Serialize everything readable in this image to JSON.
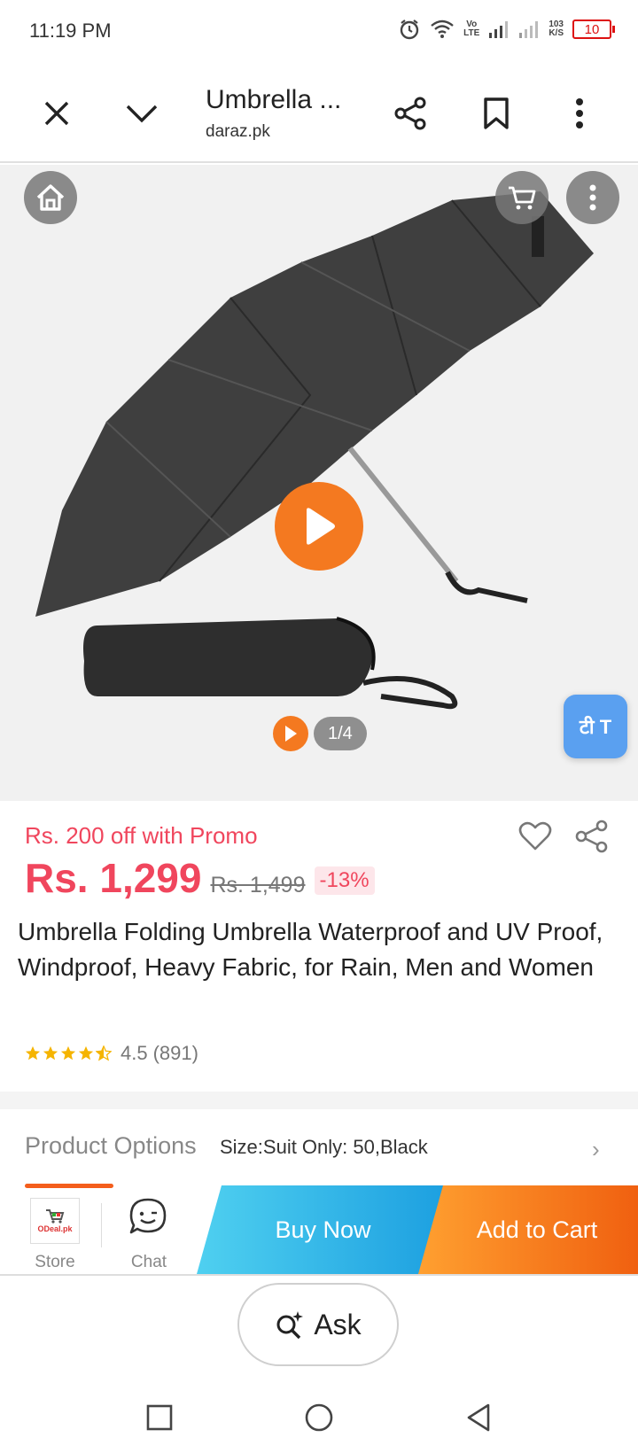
{
  "status_bar": {
    "time": "11:19 PM",
    "volte_top": "Vo",
    "volte_bottom": "LTE",
    "speed_top": "103",
    "speed_bottom": "K/S",
    "battery": "10"
  },
  "toolbar": {
    "title": "Umbrella ...",
    "domain": "daraz.pk"
  },
  "hero": {
    "counter": "1/4",
    "translate_badge": "टी T"
  },
  "product": {
    "promo": "Rs. 200 off with Promo",
    "price": "Rs. 1,299",
    "old_price": "Rs. 1,499",
    "discount": "-13%",
    "title": "Umbrella Folding Umbrella Waterproof and UV Proof, Windproof, Heavy Fabric, for Rain, Men and Women",
    "rating": "4.5",
    "reviews": "(891)",
    "stars_value": 4.5
  },
  "options": {
    "label": "Product Options",
    "value": "Size:Suit Only: 50,Black"
  },
  "action_bar": {
    "store_logo": "ODeal.pk",
    "store_label": "Store",
    "chat_label": "Chat",
    "buy_now": "Buy Now",
    "add_to_cart": "Add to Cart"
  },
  "ask": {
    "label": "Ask"
  },
  "colors": {
    "accent": "#f0465d",
    "orange": "#f47920",
    "blue": "#1c9fe0"
  }
}
